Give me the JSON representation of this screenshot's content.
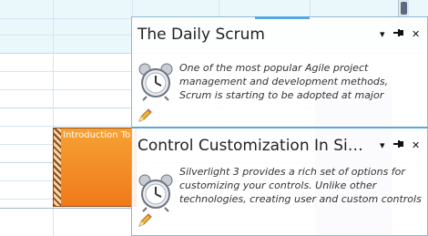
{
  "scheduler": {
    "appointment": {
      "title": "Introduction To"
    }
  },
  "popups": [
    {
      "title": "The Daily Scrum",
      "description": "One of the most popular Agile project management and development methods, Scrum is starting to be adopted at major corporations and",
      "controls": {
        "dropdown": "▾",
        "pin": "📌",
        "close": "✕"
      }
    },
    {
      "title": "Control Customization In Silv...",
      "description": "Silverlight 3 provides a rich set of options for customizing your controls. Unlike other technologies, creating user and custom controls is",
      "controls": {
        "dropdown": "▾",
        "pin": "📌",
        "close": "✕"
      }
    }
  ]
}
